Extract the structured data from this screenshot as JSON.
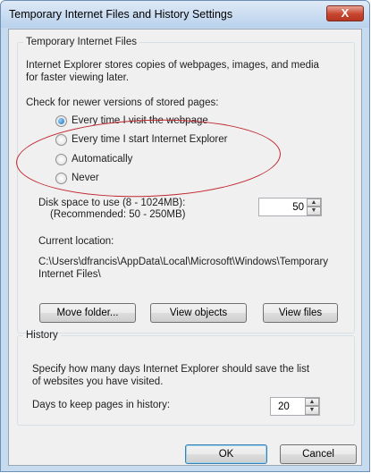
{
  "window": {
    "title": "Temporary Internet Files and History Settings",
    "close_label": "X"
  },
  "temp_files": {
    "group_label": "Temporary Internet Files",
    "description_line1": "Internet Explorer stores copies of webpages, images, and media",
    "description_line2": "for faster viewing later.",
    "check_label": "Check for newer versions of stored pages:",
    "options": [
      {
        "label": "Every time I visit the webpage",
        "checked": true
      },
      {
        "label": "Every time I start Internet Explorer",
        "checked": false
      },
      {
        "label": "Automatically",
        "checked": false
      },
      {
        "label": "Never",
        "checked": false
      }
    ],
    "disk_label_line1": "Disk space to use (8 - 1024MB):",
    "disk_label_line2": "(Recommended: 50 - 250MB)",
    "disk_value": "50",
    "location_label": "Current location:",
    "location_line1": "C:\\Users\\dfrancis\\AppData\\Local\\Microsoft\\Windows\\Temporary",
    "location_line2": "Internet Files\\",
    "buttons": {
      "move_folder": "Move folder...",
      "view_objects": "View objects",
      "view_files": "View files"
    }
  },
  "history": {
    "group_label": "History",
    "description_line1": "Specify how many days Internet Explorer should save the list",
    "description_line2": "of websites you have visited.",
    "days_label": "Days to keep pages in history:",
    "days_value": "20"
  },
  "footer": {
    "ok_label": "OK",
    "cancel_label": "Cancel"
  },
  "colors": {
    "annotation": "#c0262e",
    "close_button": "#c8452f"
  }
}
